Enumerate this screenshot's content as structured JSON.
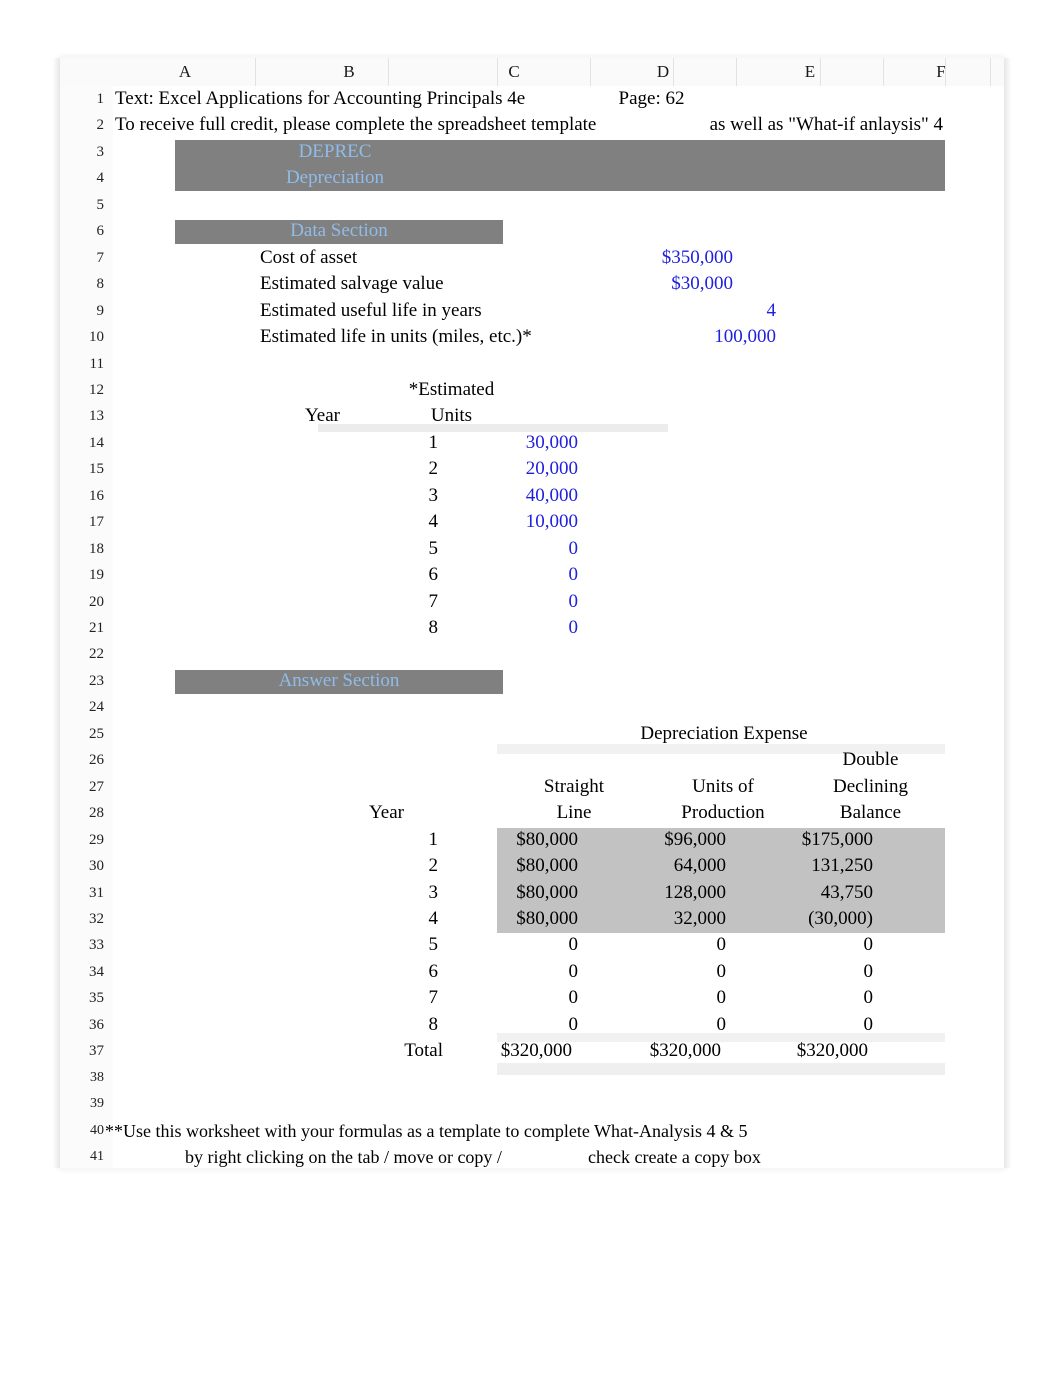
{
  "document": {
    "title": "DEPREC",
    "subtitle": "Depreciation",
    "header_line1": "Text: Excel Applications for Accounting Principals 4e",
    "header_line1_right": "Page: 62",
    "header_line2": "To receive full credit, please complete the spreadsheet template",
    "header_line2_right": "as well as \"What-if anlaysis\" 4",
    "footer_line1": "**Use this worksheet with your formulas as a template to complete What-Analysis 4 & 5",
    "footer_line2a": "by right clicking on the tab / move or copy /",
    "footer_line2b": "check create a copy box"
  },
  "colors": {
    "section_band": "#808080",
    "section_label": "#8fbce8",
    "input_value": "#2020dd",
    "answer_highlight": "#c2c2c2",
    "faint_band": "#ececec"
  },
  "grid": {
    "column_headers": [
      "A",
      "B",
      "C",
      "D",
      "E",
      "F"
    ],
    "row_numbers": [
      1,
      2,
      3,
      4,
      5,
      6,
      7,
      8,
      9,
      10,
      11,
      12,
      13,
      14,
      15,
      16,
      17,
      18,
      19,
      20,
      21,
      22,
      23,
      24,
      25,
      26,
      27,
      28,
      29,
      30,
      31,
      32,
      33,
      34,
      35,
      36,
      37,
      38,
      39,
      40,
      41
    ]
  },
  "data_section": {
    "label": "Data Section",
    "rows": [
      {
        "label": "Cost of asset",
        "value": "$350,000"
      },
      {
        "label": "Estimated salvage value",
        "value": "$30,000"
      },
      {
        "label": "Estimated useful life in years",
        "value": "4"
      },
      {
        "label": "Estimated life in units (miles, etc.)*",
        "value": "100,000"
      }
    ],
    "units_table": {
      "header_top": "*Estimated",
      "header_year": "Year",
      "header_units": "Units",
      "rows": [
        {
          "year": "1",
          "units": "30,000"
        },
        {
          "year": "2",
          "units": "20,000"
        },
        {
          "year": "3",
          "units": "40,000"
        },
        {
          "year": "4",
          "units": "10,000"
        },
        {
          "year": "5",
          "units": "0"
        },
        {
          "year": "6",
          "units": "0"
        },
        {
          "year": "7",
          "units": "0"
        },
        {
          "year": "8",
          "units": "0"
        }
      ]
    }
  },
  "answer_section": {
    "label": "Answer Section",
    "table_title": "Depreciation Expense",
    "headers": {
      "year": "Year",
      "straight_line_top": "",
      "straight_line_mid": "Straight",
      "straight_line_bot": "Line",
      "units_top": "",
      "units_mid": "Units of",
      "units_bot": "Production",
      "ddb_top": "Double",
      "ddb_mid": "Declining",
      "ddb_bot": "Balance"
    },
    "rows": [
      {
        "year": "1",
        "straight_line": "$80,000",
        "units_of_production": "$96,000",
        "double_declining": "$175,000"
      },
      {
        "year": "2",
        "straight_line": "$80,000",
        "units_of_production": "64,000",
        "double_declining": "131,250"
      },
      {
        "year": "3",
        "straight_line": "$80,000",
        "units_of_production": "128,000",
        "double_declining": "43,750"
      },
      {
        "year": "4",
        "straight_line": "$80,000",
        "units_of_production": "32,000",
        "double_declining": "(30,000)"
      },
      {
        "year": "5",
        "straight_line": "0",
        "units_of_production": "0",
        "double_declining": "0"
      },
      {
        "year": "6",
        "straight_line": "0",
        "units_of_production": "0",
        "double_declining": "0"
      },
      {
        "year": "7",
        "straight_line": "0",
        "units_of_production": "0",
        "double_declining": "0"
      },
      {
        "year": "8",
        "straight_line": "0",
        "units_of_production": "0",
        "double_declining": "0"
      }
    ],
    "total": {
      "label": "Total",
      "straight_line": "$320,000",
      "units_of_production": "$320,000",
      "double_declining": "$320,000"
    }
  }
}
